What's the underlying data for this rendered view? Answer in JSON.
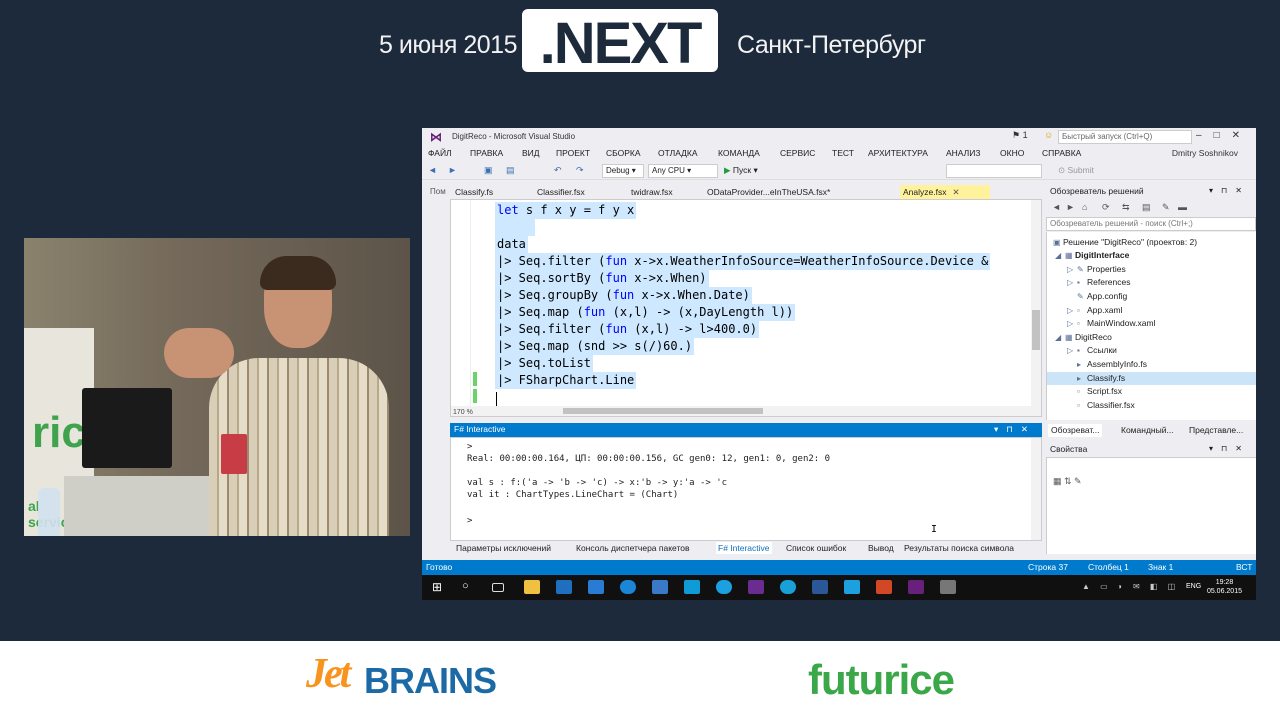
{
  "banner": {
    "date": "5 июня 2015",
    "logo": ".NEXT",
    "city": "Санкт-Петербург"
  },
  "video": {
    "backdrop_text_1": "ric",
    "backdrop_text_2": "al services"
  },
  "vs": {
    "title": "DigitReco - Microsoft Visual Studio",
    "notifications": "1",
    "quick_launch_placeholder": "Быстрый запуск (Ctrl+Q)",
    "user": "Dmitry Soshnikov",
    "menu": [
      "ФАЙЛ",
      "ПРАВКА",
      "ВИД",
      "ПРОЕКТ",
      "СБОРКА",
      "ОТЛАДКА",
      "КОМАНДА",
      "СЕРВИС",
      "ТЕСТ",
      "АРХИТЕКТУРА",
      "АНАЛИЗ",
      "ОКНО",
      "СПРАВКА"
    ],
    "toolbar": {
      "config": "Debug",
      "platform": "Any CPU",
      "start": "Пуск",
      "submit": "Submit"
    },
    "left_strip_label": "Пом",
    "doc_tabs": [
      {
        "label": "Classify.fs",
        "active": false
      },
      {
        "label": "Classifier.fsx",
        "active": false
      },
      {
        "label": "twidraw.fsx",
        "active": false
      },
      {
        "label": "ODataProvider...eInTheUSA.fsx*",
        "active": false
      },
      {
        "label": "Analyze.fsx",
        "active": true
      }
    ],
    "editor": {
      "zoom": "170 %",
      "lines": [
        {
          "kw": "let",
          "rest": " s f x y = f y x",
          "selected": true
        },
        {
          "kw": "",
          "rest": "",
          "selected": true
        },
        {
          "kw": "",
          "rest": "data",
          "selected": true
        },
        {
          "kw": "",
          "rest": "|> Seq.filter (fun x->x.WeatherInfoSource=WeatherInfoSource.Device &",
          "selected": true,
          "fun": true
        },
        {
          "kw": "",
          "rest": "|> Seq.sortBy (fun x->x.When)",
          "selected": true,
          "fun": true
        },
        {
          "kw": "",
          "rest": "|> Seq.groupBy (fun x->x.When.Date)",
          "selected": true,
          "fun": true
        },
        {
          "kw": "",
          "rest": "|> Seq.map (fun (x,l) -> (x,DayLength l))",
          "selected": true,
          "fun": true
        },
        {
          "kw": "",
          "rest": "|> Seq.filter (fun (x,l) -> l>400.0)",
          "selected": true,
          "fun": true
        },
        {
          "kw": "",
          "rest": "|> Seq.map (snd >> s(/)60.)",
          "selected": true
        },
        {
          "kw": "",
          "rest": "|> Seq.toList",
          "selected": true
        },
        {
          "kw": "",
          "rest": "|> FSharpChart.Line",
          "selected": true
        }
      ]
    },
    "fsi": {
      "title": "F# Interactive",
      "lines": [
        ">",
        "Real: 00:00:00.164, ЦП: 00:00:00.156, GC gen0: 12, gen1: 0, gen2: 0",
        "",
        "val s : f:('a -> 'b -> 'c) -> x:'b -> y:'a -> 'c",
        "val it : ChartTypes.LineChart = (Chart)",
        "",
        ">"
      ]
    },
    "bottom_tabs": [
      {
        "label": "Параметры исключений",
        "active": false
      },
      {
        "label": "Консоль диспетчера пакетов",
        "active": false
      },
      {
        "label": "F# Interactive",
        "active": true
      },
      {
        "label": "Список ошибок",
        "active": false
      },
      {
        "label": "Вывод",
        "active": false
      },
      {
        "label": "Результаты поиска символа",
        "active": false
      }
    ],
    "solution_explorer": {
      "title": "Обозреватель решений",
      "search_placeholder": "Обозреватель решений - поиск (Ctrl+;)",
      "items": [
        {
          "label": "Решение \"DigitReco\" (проектов: 2)",
          "bold": false,
          "selected": false
        },
        {
          "label": "DigitInterface",
          "bold": true,
          "selected": false
        },
        {
          "label": "Properties",
          "bold": false,
          "selected": false
        },
        {
          "label": "References",
          "bold": false,
          "selected": false
        },
        {
          "label": "App.config",
          "bold": false,
          "selected": false
        },
        {
          "label": "App.xaml",
          "bold": false,
          "selected": false
        },
        {
          "label": "MainWindow.xaml",
          "bold": false,
          "selected": false
        },
        {
          "label": "DigitReco",
          "bold": false,
          "selected": false
        },
        {
          "label": "Ссылки",
          "bold": false,
          "selected": false
        },
        {
          "label": "AssemblyInfo.fs",
          "bold": false,
          "selected": false
        },
        {
          "label": "Classify.fs",
          "bold": false,
          "selected": true
        },
        {
          "label": "Script.fsx",
          "bold": false,
          "selected": false
        },
        {
          "label": "Classifier.fsx",
          "bold": false,
          "selected": false
        }
      ],
      "tabs": [
        {
          "label": "Обозреват...",
          "active": true
        },
        {
          "label": "Командный...",
          "active": false
        },
        {
          "label": "Представле...",
          "active": false
        }
      ]
    },
    "properties": {
      "title": "Свойства"
    },
    "status": {
      "ready": "Готово",
      "line": "Строка 37",
      "column": "Столбец 1",
      "char": "Знак 1",
      "mode": "ВСТ"
    },
    "taskbar": {
      "lang": "ENG",
      "time": "19:28",
      "date": "05.06.2015"
    }
  },
  "sponsors": {
    "jetbrains_jet": "Jet",
    "jetbrains_brains": "BRAINS",
    "futurice": "futurice"
  }
}
